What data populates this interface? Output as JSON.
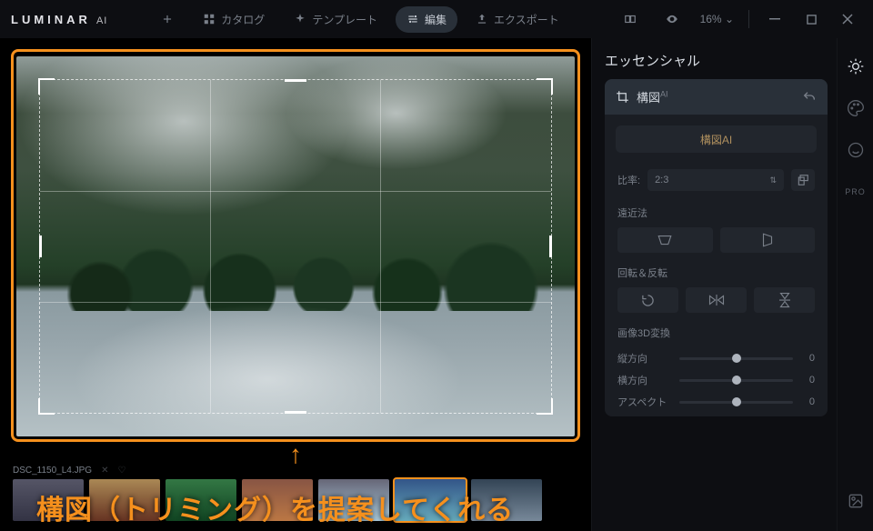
{
  "app": {
    "name": "LUMINAR",
    "suffix": "AI"
  },
  "topnav": {
    "add_label": "",
    "catalog": "カタログ",
    "templates": "テンプレート",
    "edit": "編集",
    "export": "エクスポート",
    "zoom": "16%"
  },
  "filmstrip": {
    "filename": "DSC_1150_L4.JPG"
  },
  "panel": {
    "title": "エッセンシャル",
    "tool_name": "構図",
    "tool_sup": "AI",
    "suggest": "構図AI",
    "ratio_label": "比率:",
    "ratio_value": "2:3",
    "perspective": "遠近法",
    "rotate_flip": "回転＆反転",
    "transform3d": "画像3D変換",
    "vertical": "縦方向",
    "horizontal": "横方向",
    "aspect": "アスペクト",
    "zero": "0"
  },
  "rail": {
    "pro": "PRO"
  },
  "annotation": {
    "arrow": "↑",
    "text": "構図（トリミング）を提案してくれる"
  }
}
